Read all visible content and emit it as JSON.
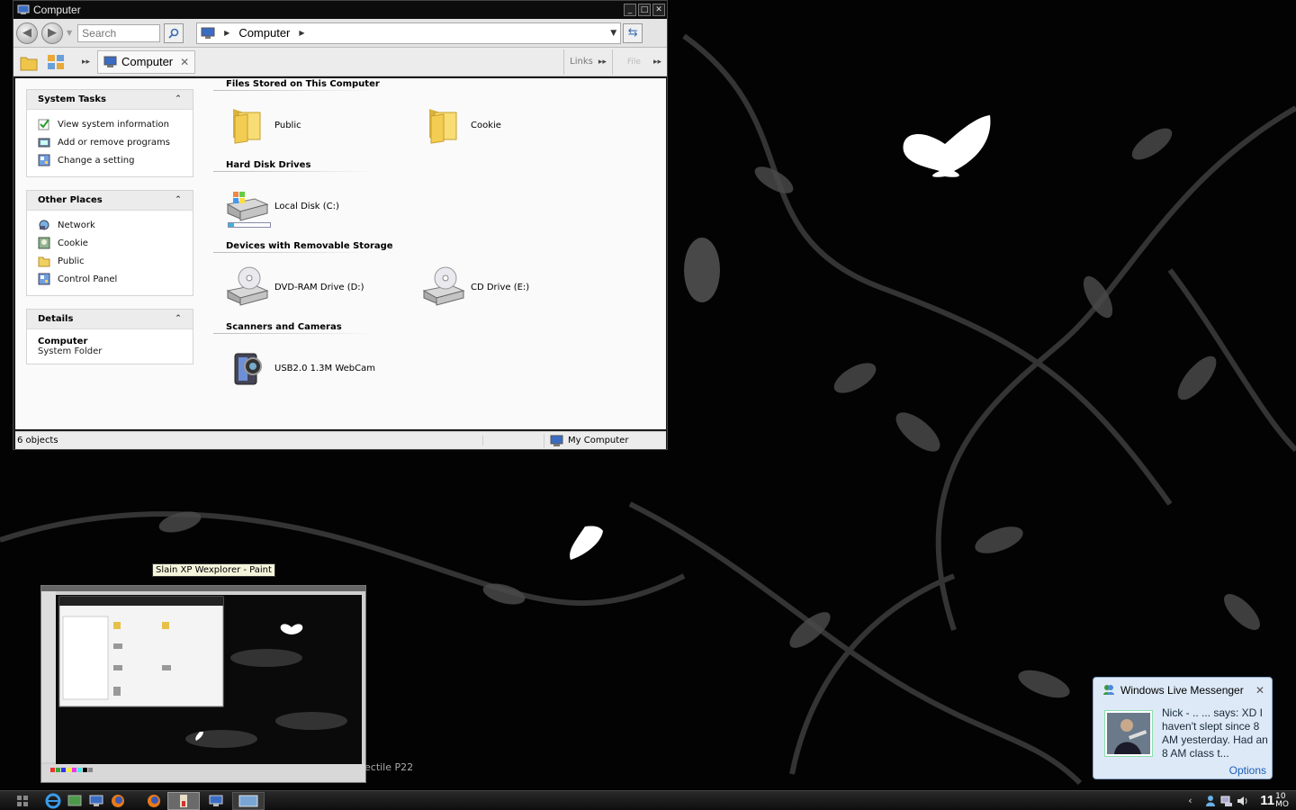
{
  "window": {
    "title": "Computer"
  },
  "search": {
    "placeholder": "Search"
  },
  "address": {
    "crumb": "Computer"
  },
  "toolbar": {
    "tab_label": "Computer",
    "links_label": "Links",
    "file_label": "File"
  },
  "sidebar": {
    "system_tasks": {
      "title": "System Tasks",
      "items": [
        {
          "label": "View system information",
          "icon": "check-icon"
        },
        {
          "label": "Add or remove programs",
          "icon": "programs-icon"
        },
        {
          "label": "Change a setting",
          "icon": "control-panel-icon"
        }
      ]
    },
    "other_places": {
      "title": "Other Places",
      "items": [
        {
          "label": "Network",
          "icon": "network-icon"
        },
        {
          "label": "Cookie",
          "icon": "user-folder-icon"
        },
        {
          "label": "Public",
          "icon": "folder-icon"
        },
        {
          "label": "Control Panel",
          "icon": "control-panel-icon"
        }
      ]
    },
    "details": {
      "title": "Details",
      "name": "Computer",
      "type": "System Folder"
    }
  },
  "groups": [
    {
      "title": "Files Stored on This Computer",
      "items": [
        {
          "label": "Public",
          "icon": "folder-icon"
        },
        {
          "label": "Cookie",
          "icon": "folder-icon"
        }
      ]
    },
    {
      "title": "Hard Disk Drives",
      "items": [
        {
          "label": "Local Disk (C:)",
          "icon": "hard-disk-icon",
          "used_fraction": 0.12
        }
      ]
    },
    {
      "title": "Devices with Removable Storage",
      "items": [
        {
          "label": "DVD-RAM Drive (D:)",
          "icon": "optical-drive-icon"
        },
        {
          "label": "CD Drive (E:)",
          "icon": "optical-drive-icon"
        }
      ]
    },
    {
      "title": "Scanners and Cameras",
      "items": [
        {
          "label": "USB2.0 1.3M WebCam",
          "icon": "webcam-icon"
        }
      ]
    }
  ],
  "status": {
    "count": "6 objects",
    "location": "My Computer"
  },
  "thumbnail": {
    "tooltip": "Slain XP Wexplorer - Paint"
  },
  "desktop": {
    "caption": "ectile P22"
  },
  "messenger": {
    "title": "Windows Live Messenger",
    "message": "Nick - .. ... says: XD I haven't slept since 8 AM yesterday. Had an 8 AM class t...",
    "options": "Options"
  },
  "clock": {
    "hour": "11",
    "minute": "10",
    "suffix": "MO"
  },
  "colors": {
    "accent": "#3a6db5",
    "toast_bg": "#dde9f7",
    "taskbar": "#1a1a1a"
  }
}
